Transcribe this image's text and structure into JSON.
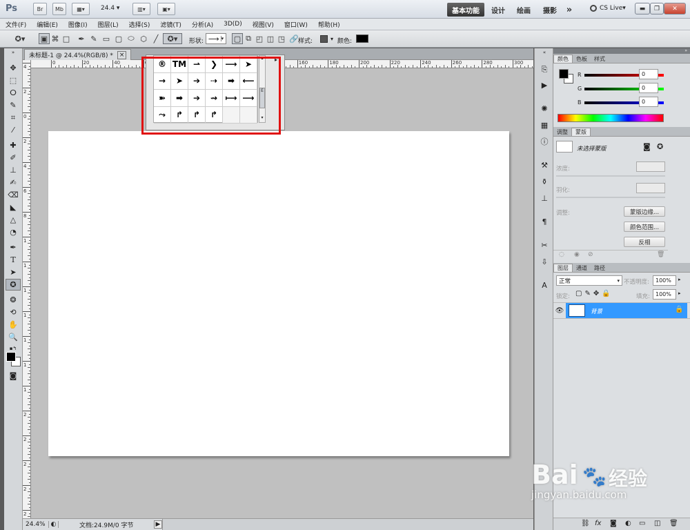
{
  "app": {
    "logo": "Ps",
    "zoom": "24.4"
  },
  "workspaces": [
    "基本功能",
    "设计",
    "绘画",
    "摄影"
  ],
  "more_label": "»",
  "cslive": "CS Live",
  "menu": [
    "文件(F)",
    "编辑(E)",
    "图像(I)",
    "图层(L)",
    "选择(S)",
    "滤镜(T)",
    "分析(A)",
    "3D(D)",
    "视图(V)",
    "窗口(W)",
    "帮助(H)"
  ],
  "options": {
    "shape_label": "形状:",
    "style_label": "样式:",
    "color_label": "颜色:",
    "color_value": "#000000"
  },
  "document": {
    "tab_title": "未标题-1 @ 24.4%(RGB/8) *",
    "close": "×"
  },
  "rulers": {
    "h_labels": [
      "0",
      "20",
      "40",
      "60",
      "80",
      "100",
      "120",
      "140",
      "160",
      "180",
      "200",
      "220",
      "240",
      "260",
      "280",
      "300"
    ],
    "v_labels": [
      "4",
      "2",
      "0",
      "2",
      "4",
      "6",
      "8",
      "1",
      "1",
      "1",
      "1",
      "1",
      "1",
      "1",
      "2",
      "2",
      "2",
      "2",
      "2"
    ]
  },
  "status": {
    "zoom": "24.4%",
    "doc_info": "文档:24.9M/0 字节"
  },
  "shape_picker": {
    "cells": [
      "®",
      "TM",
      "⇀",
      "❯",
      "⟶",
      "➤",
      "→",
      "➤",
      "➔",
      "⇢",
      "➡",
      "⟵",
      "➽",
      "➡",
      "➔",
      "⇝",
      "⟼",
      "⟶",
      "⤳",
      "↱",
      "↱",
      "↱",
      "",
      ""
    ],
    "scroll_label": "E"
  },
  "color_panel": {
    "tabs": [
      "颜色",
      "色板",
      "样式"
    ],
    "channels": [
      {
        "name": "R",
        "value": "0"
      },
      {
        "name": "G",
        "value": "0"
      },
      {
        "name": "B",
        "value": "0"
      }
    ],
    "foreground": "#000000"
  },
  "masks_panel": {
    "tabs": [
      "调整",
      "蒙版"
    ],
    "mask_title": "未选择蒙版",
    "density_label": "浓度:",
    "feather_label": "羽化:",
    "refine_label": "调整:",
    "buttons": [
      "蒙版边缘...",
      "颜色范围...",
      "反相"
    ]
  },
  "layers_panel": {
    "tabs": [
      "图层",
      "通道",
      "路径"
    ],
    "blend_mode": "正常",
    "opacity_label": "不透明度:",
    "opacity": "100%",
    "lock_label": "锁定:",
    "fill_label": "填充:",
    "fill": "100%",
    "layers": [
      {
        "name": "背景"
      }
    ]
  },
  "watermark": {
    "brand": "Bai",
    "brand_cn": "经验",
    "url": "jingyan.baidu.com"
  }
}
